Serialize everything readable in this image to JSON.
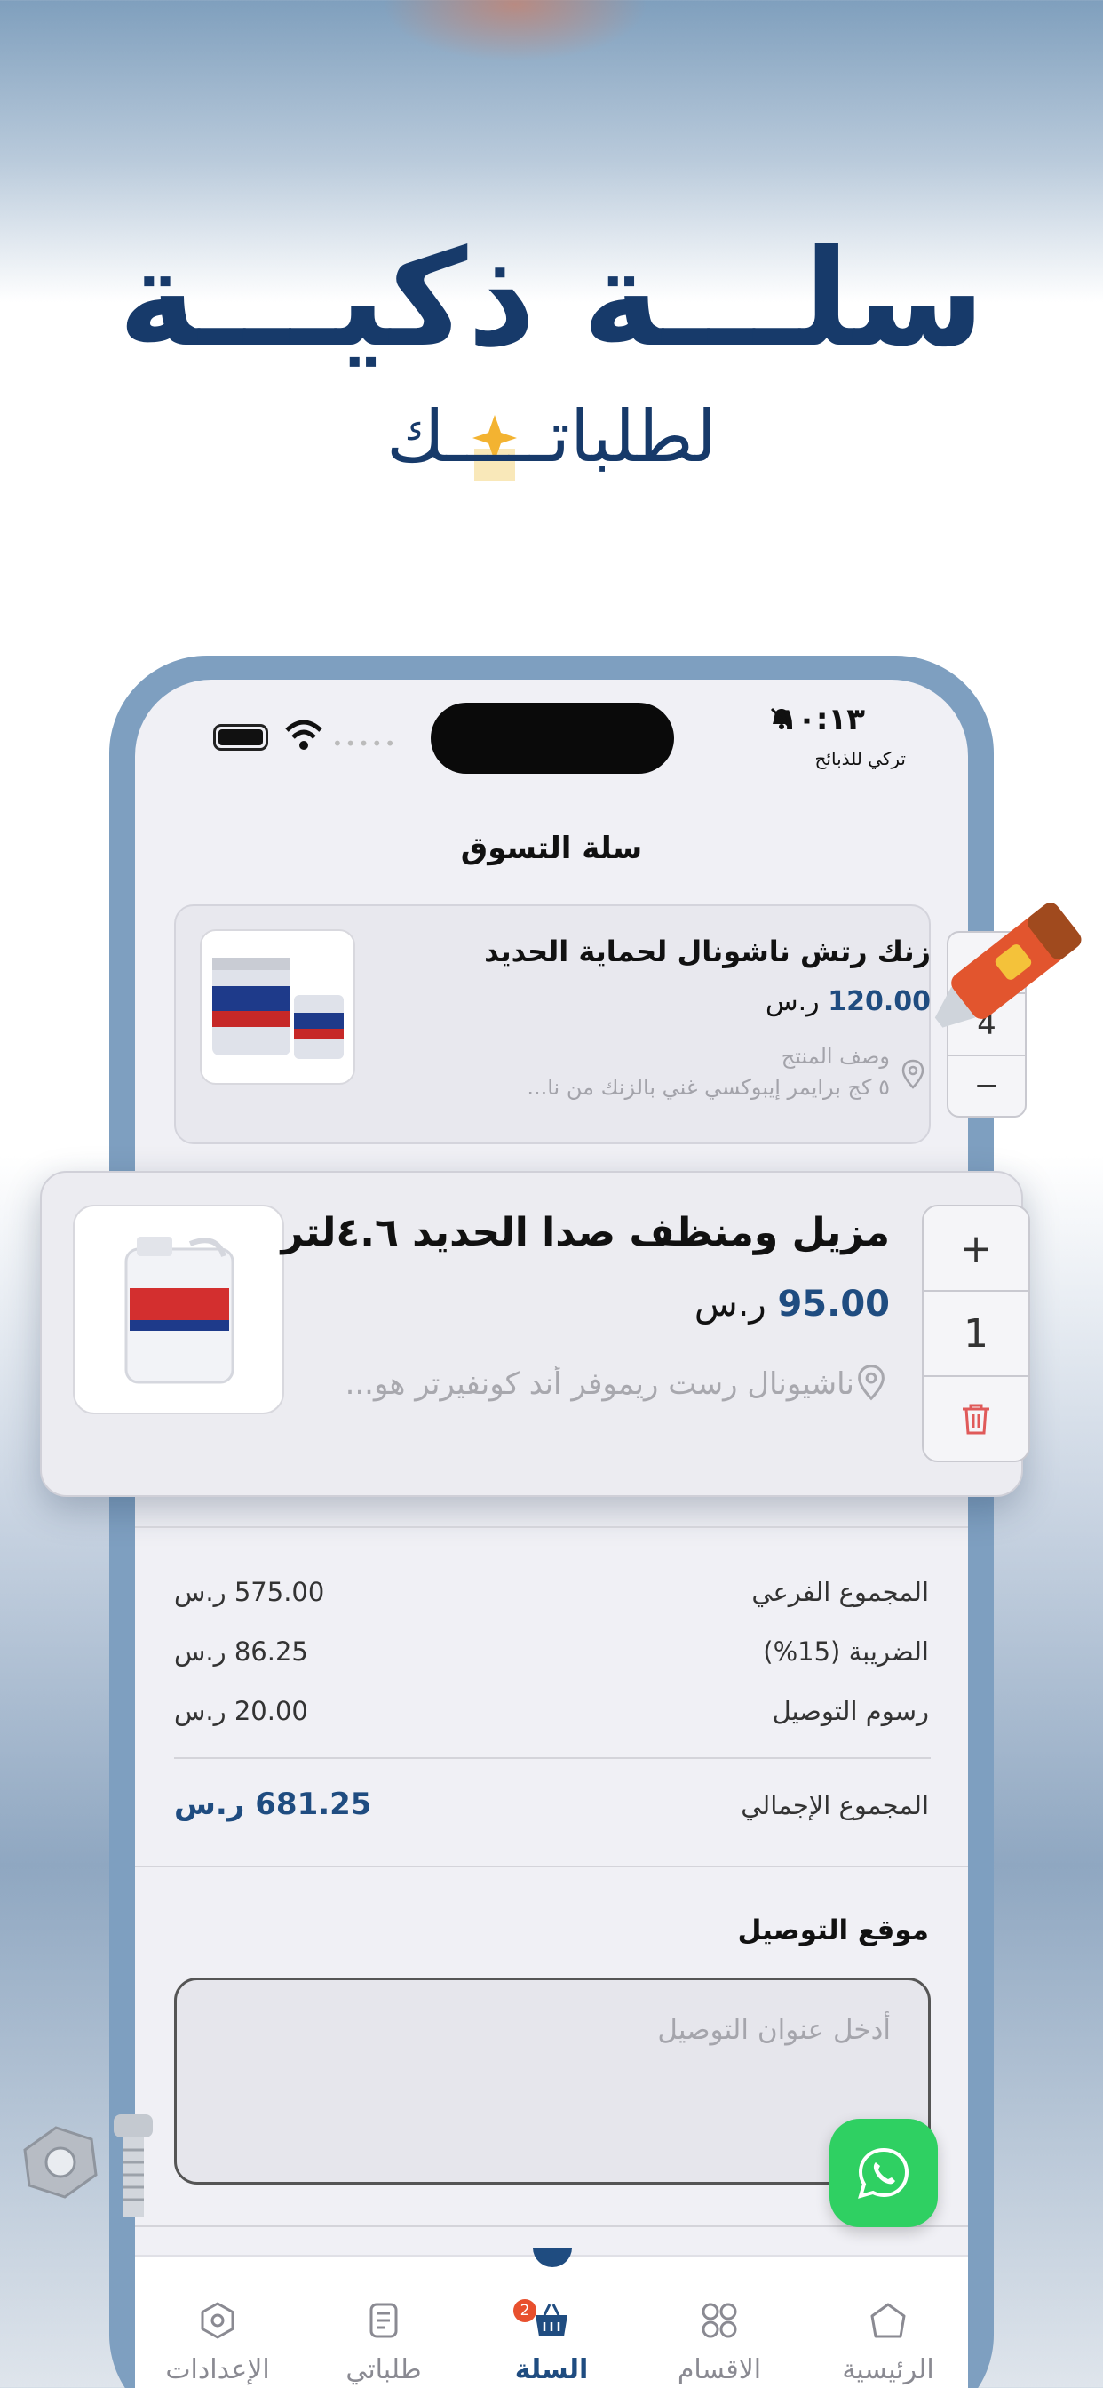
{
  "hero": {
    "title": "سلـــة ذكيـــة",
    "subtitle": "لطلباتـــــك"
  },
  "status_bar": {
    "time": "١٠:١٣",
    "carrier": "تركي للذبائح"
  },
  "page": {
    "title": "سلة التسوق"
  },
  "cart_items": [
    {
      "name": "زنك رتش ناشونال لحماية الحديد",
      "price": "120.00",
      "currency": "ر.س",
      "desc_label": "وصف المنتج",
      "description": "٥ كج برايمر إيبوكسي غني بالزنك من نا...",
      "quantity": "4",
      "plus": "+",
      "minus": "−"
    },
    {
      "name": "مزيل ومنظف صدا الحديد ٤.٦لتر",
      "price": "95.00",
      "currency": "ر.س",
      "description": "ناشيونال رست ريموفر أند كونفيرتر هو...",
      "quantity": "1",
      "plus": "+"
    }
  ],
  "totals": {
    "subtotal_label": "المجموع الفرعي",
    "subtotal_value": "575.00 ر.س",
    "tax_label": "الضريبة (15%)",
    "tax_value": "86.25 ر.س",
    "delivery_label": "رسوم التوصيل",
    "delivery_value": "20.00 ر.س",
    "grand_label": "المجموع الإجمالي",
    "grand_value": "681.25 ر.س"
  },
  "delivery": {
    "title": "موقع التوصيل",
    "placeholder": "أدخل عنوان التوصيل"
  },
  "tabbar": {
    "items": [
      {
        "label": "الرئيسية",
        "icon": "home-icon"
      },
      {
        "label": "الاقسام",
        "icon": "grid-icon"
      },
      {
        "label": "السلة",
        "icon": "basket-icon",
        "badge": "2"
      },
      {
        "label": "طلباتي",
        "icon": "orders-icon"
      },
      {
        "label": "الإعدادات",
        "icon": "settings-icon"
      }
    ],
    "active": "السلة"
  },
  "colors": {
    "brand": "#1f4c80",
    "whatsapp": "#2fd062",
    "badge": "#e8502e"
  }
}
